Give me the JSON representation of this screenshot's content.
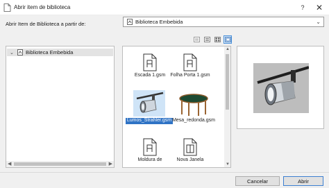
{
  "window": {
    "title": "Abrir item de biblioteca",
    "help_glyph": "?",
    "close_glyph": "✕"
  },
  "source": {
    "label": "Abrir Item de Biblioteca a partir de:",
    "selected": "Biblioteca Embebida"
  },
  "tree": {
    "items": [
      {
        "label": "Biblioteca Embebida",
        "expanded": true
      }
    ]
  },
  "view_modes": [
    "details",
    "list",
    "small-icons",
    "large-icons"
  ],
  "active_view": "large-icons",
  "grid": {
    "items": [
      {
        "label": "Escada 1.gsm",
        "icon": "gsm-file-icon",
        "selected": false
      },
      {
        "label": "Folha Porta 1.gsm",
        "icon": "gsm-file-icon",
        "selected": false
      },
      {
        "label": "Lumos_Strahler.gsm",
        "icon": "spotlight-thumbnail",
        "selected": true
      },
      {
        "label": "Mesa_redonda.gsm",
        "icon": "round-table-thumbnail",
        "selected": false
      },
      {
        "label": "Moldura de",
        "icon": "gsm-file-icon",
        "selected": false
      },
      {
        "label": "Nova Janela",
        "icon": "window-file-icon",
        "selected": false
      }
    ]
  },
  "buttons": {
    "cancel": "Cancelar",
    "open": "Abrir"
  },
  "colors": {
    "selection": "#2f73c5",
    "accent_border": "#3c7fd1"
  }
}
